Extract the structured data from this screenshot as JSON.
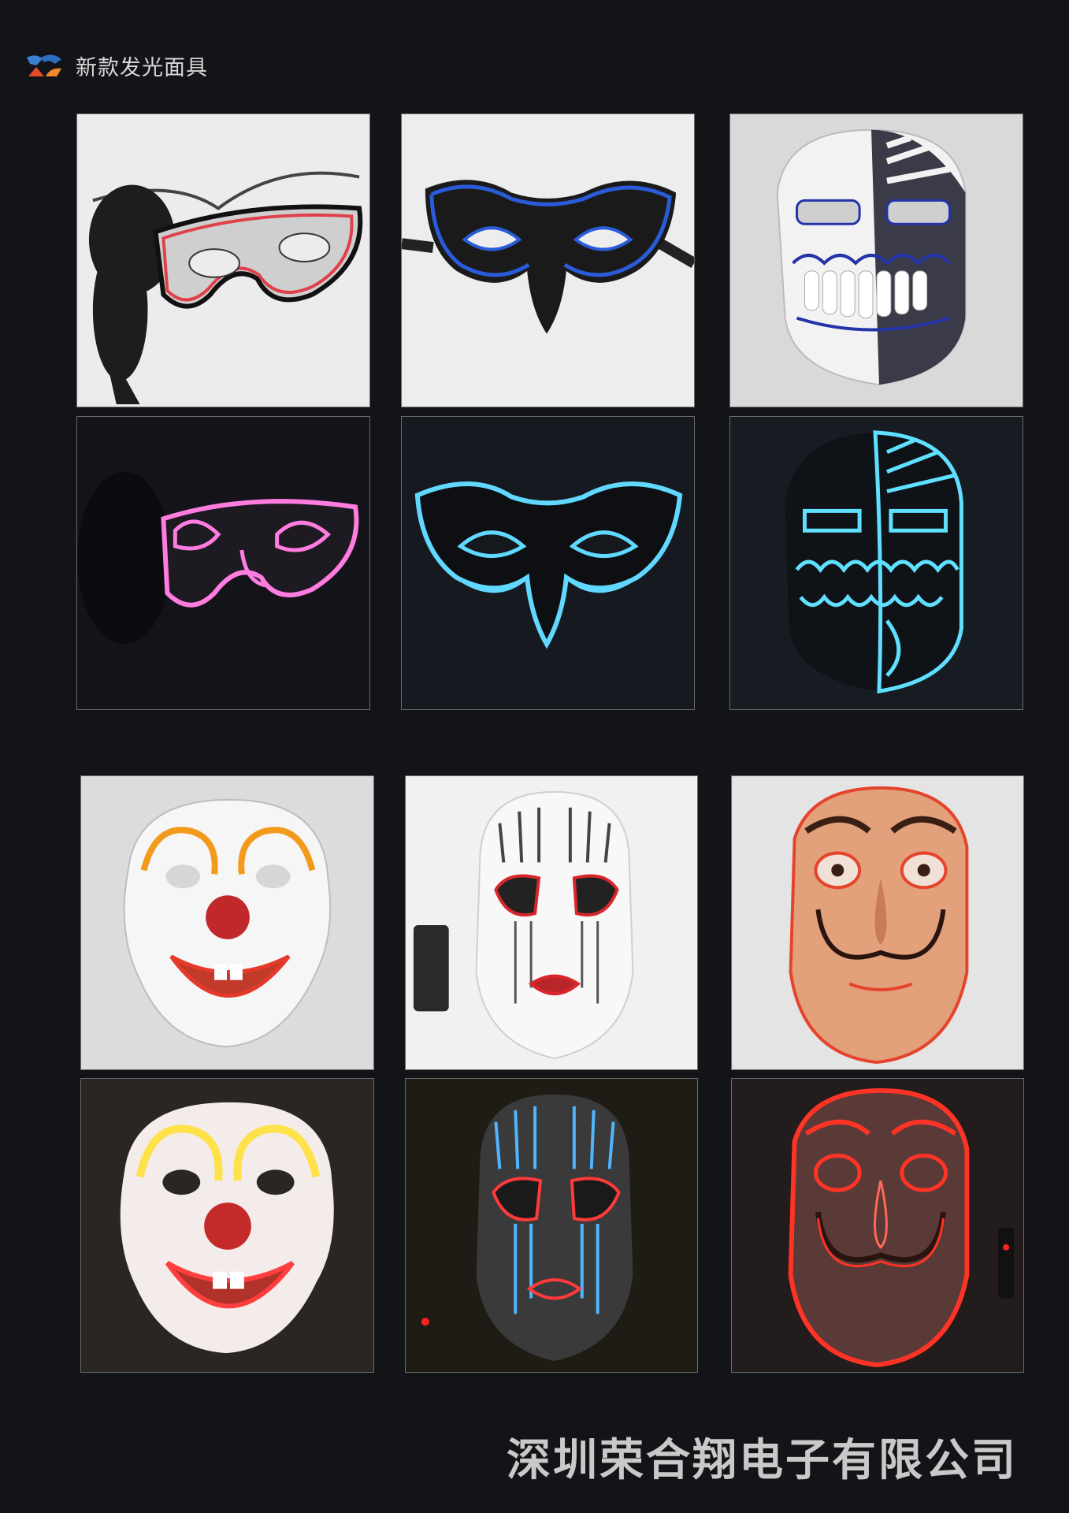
{
  "header": {
    "title": "新款发光面具",
    "logo_icon": "company-logo-icon"
  },
  "photos": [
    {
      "name": "masquerade-lace-mask-day",
      "icon": "masquerade-mask-icon",
      "bg": "#ececec",
      "glow": "#e0404a"
    },
    {
      "name": "venetian-mask-day",
      "icon": "venetian-mask-icon",
      "bg": "#ededed",
      "glow": "#2a5bd8"
    },
    {
      "name": "skull-half-mask-day",
      "icon": "skull-mask-icon",
      "bg": "#d9d9d9",
      "glow": "#2433a8"
    },
    {
      "name": "masquerade-lace-mask-glow",
      "icon": "masquerade-mask-icon",
      "bg": "#15131a",
      "glow": "#ff7ce0"
    },
    {
      "name": "venetian-mask-glow",
      "icon": "venetian-mask-icon",
      "bg": "#161a20",
      "glow": "#61d8ff"
    },
    {
      "name": "skull-half-mask-glow",
      "icon": "skull-mask-icon",
      "bg": "#171c22",
      "glow": "#5fe0ff"
    },
    {
      "name": "clown-mask-day",
      "icon": "clown-mask-icon",
      "bg": "#dcdcdc",
      "glow": "#f29a1c"
    },
    {
      "name": "tribal-face-mask-day",
      "icon": "tribal-mask-icon",
      "bg": "#f1f1f1",
      "glow": "#d8262b"
    },
    {
      "name": "dali-mask-day",
      "icon": "dali-mask-icon",
      "bg": "#e4e4e4",
      "glow": "#e5442c"
    },
    {
      "name": "clown-mask-glow",
      "icon": "clown-mask-icon",
      "bg": "#2a2624",
      "glow": "#ffe24a"
    },
    {
      "name": "tribal-face-mask-glow",
      "icon": "tribal-mask-icon",
      "bg": "#1f1c16",
      "glow": "#4fb5ff"
    },
    {
      "name": "dali-mask-glow",
      "icon": "dali-mask-icon",
      "bg": "#221c1c",
      "glow": "#ff3326"
    }
  ],
  "footer": {
    "company": "深圳荣合翔电子有限公司"
  }
}
